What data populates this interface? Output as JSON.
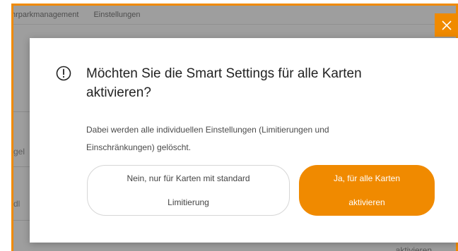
{
  "nav": {
    "items": [
      "hrparkmanagement",
      "Einstellungen"
    ]
  },
  "background": {
    "row_label_1": "gel",
    "row_label_2": "dl",
    "link": "aktivieren"
  },
  "dialog": {
    "title": "Möchten Sie die Smart Settings für alle Karten aktivieren?",
    "description": "Dabei werden alle individuellen Einstellungen (Limitierungen und Einschränkungen) gelöscht.",
    "secondary_button": "Nein, nur für Karten mit standard Limitierung",
    "primary_button": "Ja, für alle Karten aktivieren",
    "icons": {
      "warning": "exclamation-circle-icon",
      "close": "close-icon"
    }
  },
  "colors": {
    "accent": "#f08a00",
    "overlay": "#282828",
    "text": "#222222"
  }
}
